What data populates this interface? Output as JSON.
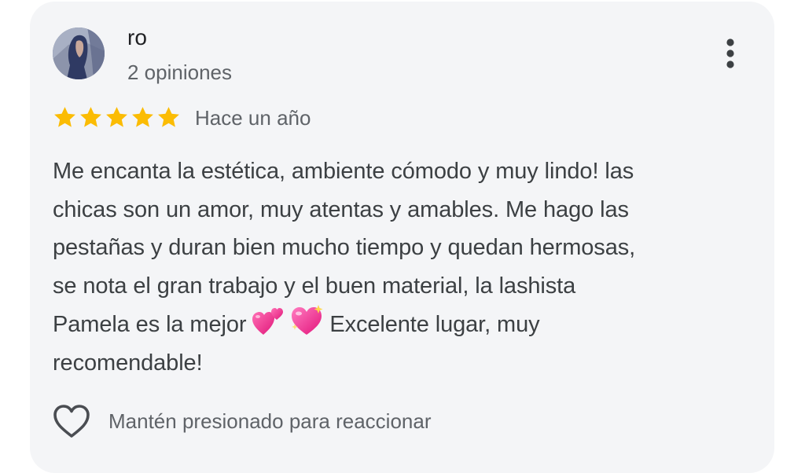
{
  "review": {
    "author": {
      "name": "ro",
      "reviews_count": "2 opiniones",
      "avatar_icon": "user-photo"
    },
    "more_icon": "more-vert-icon",
    "rating": {
      "value": 5,
      "max": 5,
      "star_color": "#fbbc04"
    },
    "time": "Hace un año",
    "text": {
      "line1": "Me encanta la estética, ambiente cómodo y muy lindo! las",
      "line2": "chicas son un amor, muy atentas y amables. Me hago las",
      "line3": "pestañas y duran bien mucho tiempo y quedan hermosas,",
      "line4": "se nota el gran trabajo y el buen material, la lashista",
      "line5_before_emoji": "Pamela es la mejor",
      "line5_after_emoji": "Excelente lugar, muy",
      "line6": "recomendable!",
      "emojis": [
        "two-hearts-emoji",
        "sparkling-heart-emoji"
      ]
    },
    "react": {
      "icon": "heart-outline-icon",
      "hint": "Mantén presionado para reaccionar"
    }
  }
}
